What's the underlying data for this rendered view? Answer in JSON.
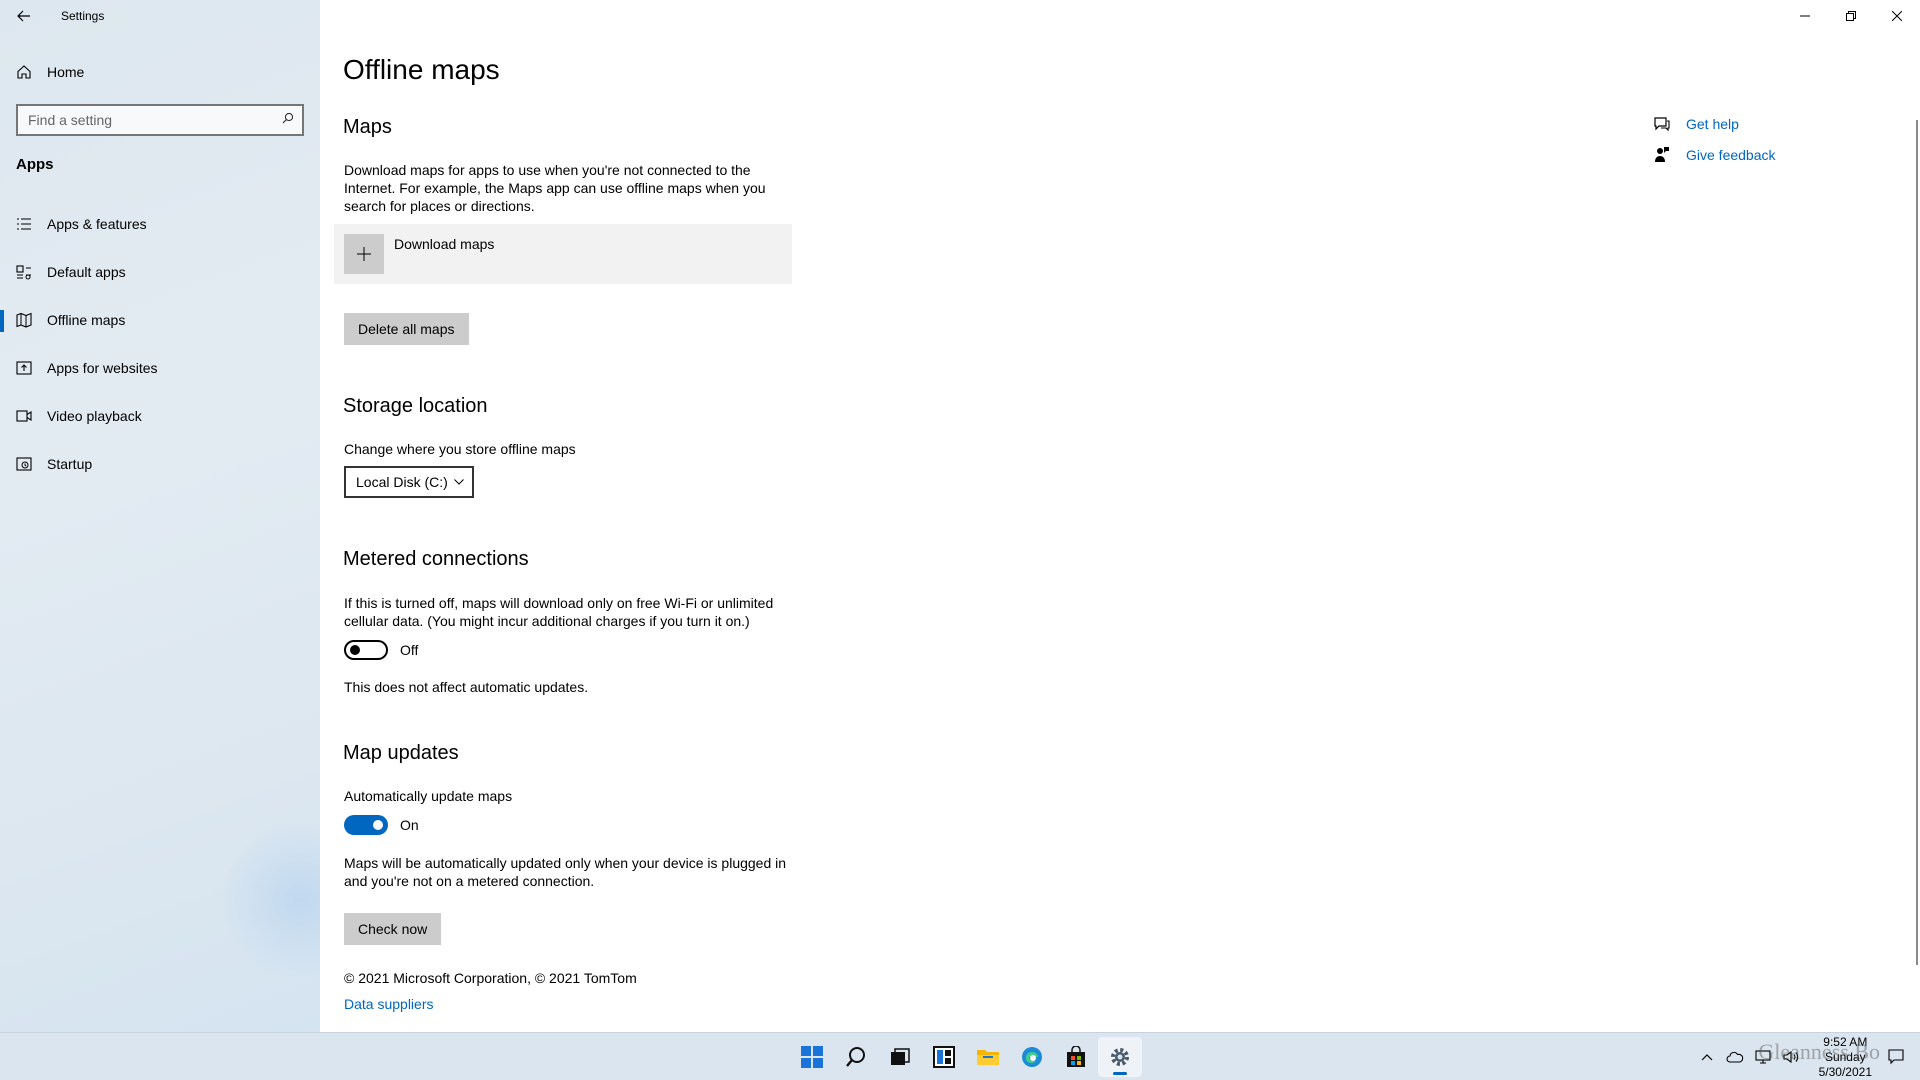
{
  "window": {
    "title": "Settings"
  },
  "sidebar": {
    "home_label": "Home",
    "search_placeholder": "Find a setting",
    "section_title": "Apps",
    "items": [
      {
        "label": "Apps & features",
        "icon": "list-icon"
      },
      {
        "label": "Default apps",
        "icon": "default-apps-icon"
      },
      {
        "label": "Offline maps",
        "icon": "map-icon",
        "active": true
      },
      {
        "label": "Apps for websites",
        "icon": "web-link-icon"
      },
      {
        "label": "Video playback",
        "icon": "video-icon"
      },
      {
        "label": "Startup",
        "icon": "startup-icon"
      }
    ]
  },
  "main": {
    "title": "Offline maps",
    "maps": {
      "heading": "Maps",
      "description": "Download maps for apps to use when you're not connected to the Internet. For example, the Maps app can use offline maps when you search for places or directions.",
      "download_label": "Download maps",
      "delete_label": "Delete all maps"
    },
    "storage": {
      "heading": "Storage location",
      "description": "Change where you store offline maps",
      "selected": "Local Disk (C:)"
    },
    "metered": {
      "heading": "Metered connections",
      "description": "If this is turned off, maps will download only on free Wi-Fi or unlimited cellular data. (You might incur additional charges if you turn it on.)",
      "toggle_state": "Off",
      "note": "This does not affect automatic updates."
    },
    "updates": {
      "heading": "Map updates",
      "toggle_caption": "Automatically update maps",
      "toggle_state": "On",
      "description": "Maps will be automatically updated only when your device is plugged in and you're not on a metered connection.",
      "check_label": "Check now"
    },
    "copyright": "© 2021 Microsoft Corporation, © 2021 TomTom",
    "suppliers_link": "Data suppliers"
  },
  "help": {
    "get_help": "Get help",
    "give_feedback": "Give feedback"
  },
  "taskbar": {
    "apps": [
      "start-icon",
      "search-icon",
      "task-view-icon",
      "widgets-icon",
      "file-explorer-icon",
      "edge-icon",
      "store-icon",
      "settings-icon"
    ],
    "time": "9:52 AM",
    "day": "Sunday",
    "date": "5/30/2021",
    "watermark": "Gleanness Bo"
  },
  "colors": {
    "accent": "#0067c0",
    "sidebar_bg": "#e3ebf2",
    "button_bg": "#cccccc"
  }
}
